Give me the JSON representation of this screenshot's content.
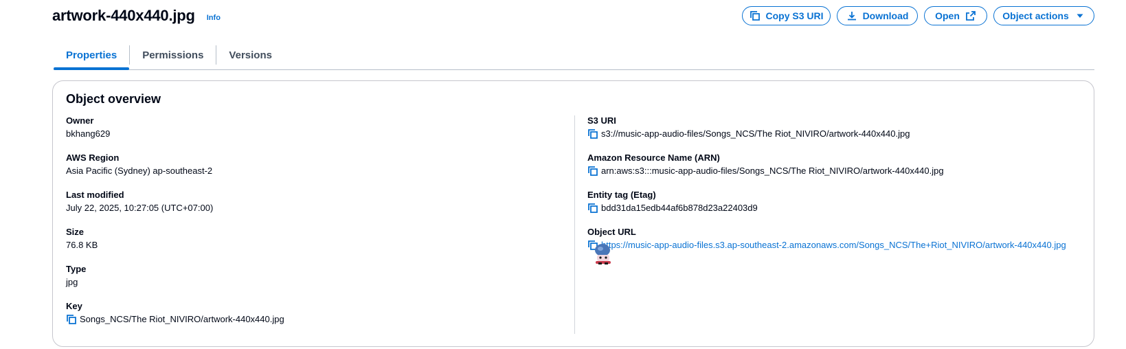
{
  "header": {
    "title": "artwork-440x440.jpg",
    "info": "Info",
    "buttons": {
      "copy_s3_uri": "Copy S3 URI",
      "download": "Download",
      "open": "Open",
      "object_actions": "Object actions"
    }
  },
  "tabs": [
    {
      "label": "Properties",
      "active": true
    },
    {
      "label": "Permissions",
      "active": false
    },
    {
      "label": "Versions",
      "active": false
    }
  ],
  "overview": {
    "title": "Object overview",
    "left": [
      {
        "label": "Owner",
        "value": "bkhang629"
      },
      {
        "label": "AWS Region",
        "value": "Asia Pacific (Sydney) ap-southeast-2"
      },
      {
        "label": "Last modified",
        "value": "July 22, 2025, 10:27:05 (UTC+07:00)"
      },
      {
        "label": "Size",
        "value": "76.8 KB"
      },
      {
        "label": "Type",
        "value": "jpg"
      },
      {
        "label": "Key",
        "value": "Songs_NCS/The Riot_NIVIRO/artwork-440x440.jpg"
      }
    ],
    "right": [
      {
        "label": "S3 URI",
        "value": "s3://music-app-audio-files/Songs_NCS/The Riot_NIVIRO/artwork-440x440.jpg"
      },
      {
        "label": "Amazon Resource Name (ARN)",
        "value": "arn:aws:s3:::music-app-audio-files/Songs_NCS/The Riot_NIVIRO/artwork-440x440.jpg"
      },
      {
        "label": "Entity tag (Etag)",
        "value": "bdd31da15edb44af6b878d23a22403d9"
      },
      {
        "label": "Object URL",
        "value": "https://music-app-audio-files.s3.ap-southeast-2.amazonaws.com/Songs_NCS/The+Riot_NIVIRO/artwork-440x440.jpg"
      }
    ]
  },
  "colors": {
    "accent": "#0972d3",
    "text": "#000716",
    "border": "#c6c6cd"
  }
}
